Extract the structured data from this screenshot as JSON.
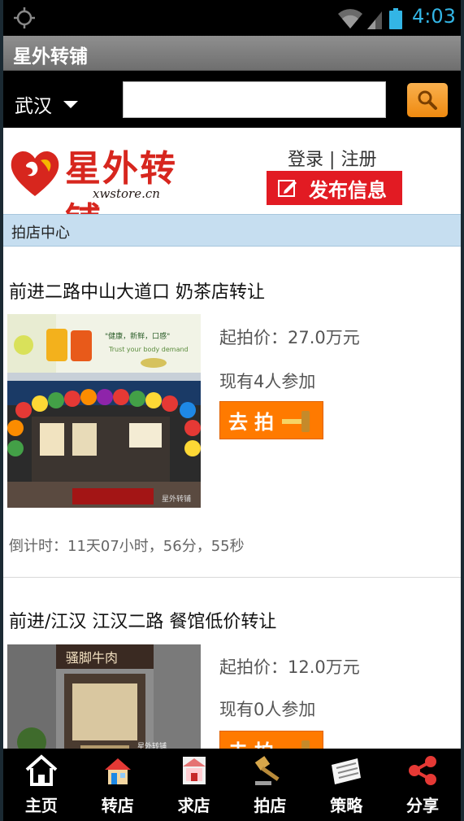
{
  "status_bar": {
    "time": "4:03"
  },
  "app": {
    "title": "星外转铺"
  },
  "search": {
    "city": "武汉",
    "placeholder": ""
  },
  "header": {
    "logo_text": "星外转铺",
    "logo_url": "xwstore.cn",
    "login": "登录",
    "separator": "|",
    "register": "注册",
    "publish": "发布信息"
  },
  "section": {
    "title": "拍店中心"
  },
  "listings": [
    {
      "title": "前进二路中山大道口 奶茶店转让",
      "price": "起拍价：27.0万元",
      "participants": "现有4人参加",
      "bid": "去拍",
      "countdown": "倒计时：11天07小时，56分，55秒"
    },
    {
      "title": "前进/江汉 江汉二路 餐馆低价转让",
      "price": "起拍价：12.0万元",
      "participants": "现有0人参加",
      "bid": "去拍"
    }
  ],
  "bottom_nav": [
    {
      "label": "主页",
      "icon": "home-icon"
    },
    {
      "label": "转店",
      "icon": "transfer-shop-icon"
    },
    {
      "label": "求店",
      "icon": "seek-shop-icon"
    },
    {
      "label": "拍店",
      "icon": "auction-hammer-icon"
    },
    {
      "label": "策略",
      "icon": "strategy-icon"
    },
    {
      "label": "分享",
      "icon": "share-icon"
    }
  ],
  "colors": {
    "accent_red": "#e21b23",
    "accent_orange": "#ff7a00",
    "section_bg": "#c6def0",
    "status_blue": "#33b5e5"
  }
}
